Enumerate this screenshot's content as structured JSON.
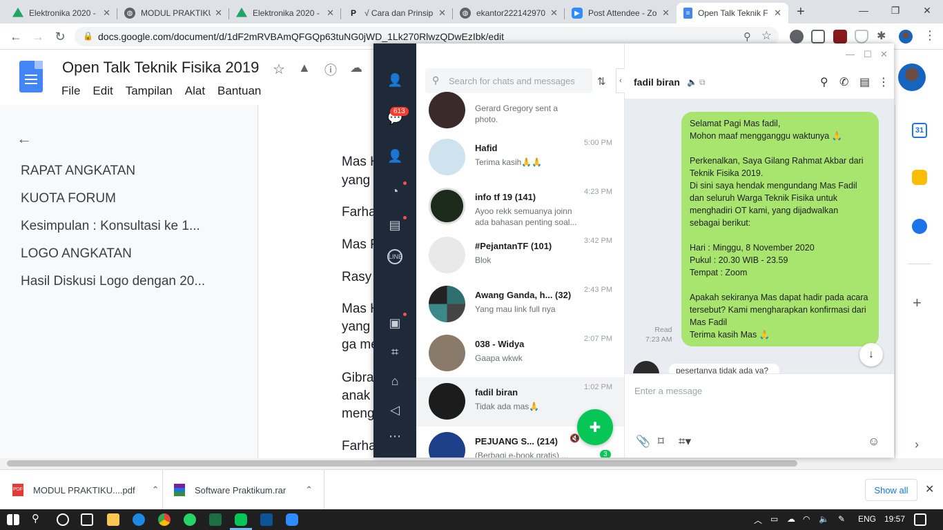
{
  "tabs": [
    {
      "title": "Elektronika 2020 -",
      "icon": "drive-icon",
      "color": "#1fa463"
    },
    {
      "title": "MODUL PRAKTIKUM",
      "icon": "globe-icon",
      "color": "#5f6368"
    },
    {
      "title": "Elektronika 2020 -",
      "icon": "drive-icon",
      "color": "#1fa463"
    },
    {
      "title": "√ Cara dan Prinsip",
      "icon": "p-icon",
      "color": "#202124"
    },
    {
      "title": "ekantor222142970",
      "icon": "globe-icon",
      "color": "#5f6368"
    },
    {
      "title": "Post Attendee - Zo",
      "icon": "zoom-icon",
      "color": "#2d8cff"
    },
    {
      "title": "Open Talk Teknik F",
      "icon": "docs-icon",
      "color": "#4285f4"
    }
  ],
  "address": {
    "url": "docs.google.com/document/d/1dF2mRVBAmQFGQp63tuNG0jWD_1Lk270RlwzQDwEzIbk/edit"
  },
  "docs": {
    "title": "Open Talk Teknik Fisika 2019",
    "menu": [
      "File",
      "Edit",
      "Tampilan",
      "Alat",
      "Bantuan"
    ]
  },
  "outline": [
    "RAPAT ANGKATAN",
    "KUOTA FORUM",
    "Kesimpulan : Konsultasi ke 1...",
    "LOGO ANGKATAN",
    "Hasil Diskusi Logo dengan 20..."
  ],
  "doc_lines": [
    "Mas H",
    "yang",
    "Farha",
    "Mas F",
    "Rasy",
    "Mas H",
    "yang",
    "ga me",
    "Gibra",
    "anak",
    "meng",
    "Farha"
  ],
  "line": {
    "badge": "613",
    "search_placeholder": "Search for chats and messages",
    "chats": [
      {
        "name": "",
        "preview": "Gerard Gregory sent a photo.",
        "time": "",
        "avatar_color": "#3a2a2a"
      },
      {
        "name": "Hafid",
        "preview": "Terima kasih🙏🙏",
        "time": "5:00 PM",
        "avatar_color": "#cfe3ef"
      },
      {
        "name": "info tf 19 (141)",
        "preview": "Ayoo rekk semuanya joinn ada bahasan penting soal...",
        "time": "4:23 PM",
        "avatar_color": "#1b2a1b"
      },
      {
        "name": "#PejantanTF (101)",
        "preview": "Blok",
        "time": "3:42 PM",
        "avatar_color": "#e9e9e9"
      },
      {
        "name": "Awang Ganda, h... (32)",
        "preview": "Yang mau link full nya",
        "time": "2:43 PM",
        "avatar_color": "#2f6f6f"
      },
      {
        "name": "038 - Widya",
        "preview": "Gaapa wkwk",
        "time": "2:07 PM",
        "avatar_color": "#8a7a6a"
      },
      {
        "name": "fadil biran",
        "preview": "Tidak ada mas🙏",
        "time": "1:02 PM",
        "avatar_color": "#1c1c1c"
      },
      {
        "name": "PEJUANG S... (214)",
        "preview": "(Berbagi e-book gratis) ...",
        "time": "",
        "avatar_color": "#1e3f8a"
      }
    ],
    "unread_count": "3",
    "conversation": {
      "name": "fadil biran",
      "message": "Selamat Pagi Mas fadil,\nMohon maaf mengganggu waktunya 🙏\n\nPerkenalkan, Saya Gilang Rahmat Akbar dari Teknik Fisika 2019.\nDi sini saya hendak mengundang Mas Fadil dan seluruh Warga Teknik Fisika untuk menghadiri OT kami, yang dijadwalkan sebagai berikut:\n\nHari : Minggu, 8 November 2020\nPukul : 20.30 WIB - 23.59\nTempat : Zoom\n\nApakah sekiranya Mas dapat hadir pada acara tersebut? Kami mengharapkan konfirmasi dari Mas Fadil\nTerima kasih Mas 🙏",
      "read_label": "Read",
      "read_time": "7:23 AM",
      "incoming_preview": "pesertanya tidak ada ya?",
      "input_placeholder": "Enter a message"
    }
  },
  "downloads": [
    {
      "name": "MODUL PRAKTIKU....pdf",
      "icon": "pdf-icon"
    },
    {
      "name": "Software Praktikum.rar",
      "icon": "rar-icon"
    }
  ],
  "show_all": "Show all",
  "taskbar": {
    "lang": "ENG",
    "time": "19:57"
  }
}
